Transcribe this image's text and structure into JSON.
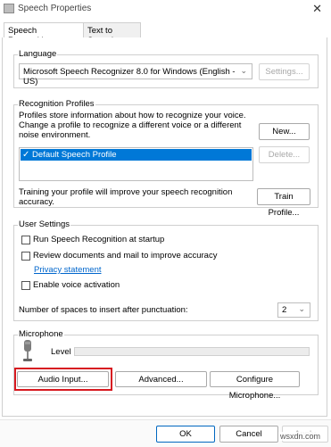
{
  "window": {
    "title": "Speech Properties",
    "close_glyph": "✕"
  },
  "tabs": [
    {
      "label": "Speech Recognition",
      "active": true
    },
    {
      "label": "Text to Speech",
      "active": false
    }
  ],
  "language": {
    "group_label": "Language",
    "selected": "Microsoft Speech Recognizer 8.0 for Windows (English - US)",
    "settings_label": "Settings..."
  },
  "profiles": {
    "group_label": "Recognition Profiles",
    "description": "Profiles store information about how to recognize your voice. Change a profile to recognize a different voice or a different noise environment.",
    "items": [
      {
        "label": "Default Speech Profile",
        "checked": true
      }
    ],
    "new_label": "New...",
    "delete_label": "Delete...",
    "training_text": "Training your profile will improve your speech recognition accuracy.",
    "train_label": "Train Profile..."
  },
  "user_settings": {
    "group_label": "User Settings",
    "run_at_startup": "Run Speech Recognition at startup",
    "review_docs": "Review documents and mail to improve accuracy",
    "privacy_link": "Privacy statement",
    "voice_activation": "Enable voice activation",
    "spaces_label": "Number of spaces to insert after punctuation:",
    "spaces_value": "2"
  },
  "microphone": {
    "group_label": "Microphone",
    "level_label": "Level",
    "level_fill": 0,
    "audio_input_label": "Audio Input...",
    "advanced_label": "Advanced...",
    "configure_label": "Configure Microphone..."
  },
  "footer": {
    "ok_label": "OK",
    "cancel_label": "Cancel",
    "apply_label": "Apply"
  },
  "watermark": "wsxdn.com",
  "colors": {
    "accent": "#0078d7",
    "highlight": "#d71920",
    "link": "#0066cc"
  }
}
